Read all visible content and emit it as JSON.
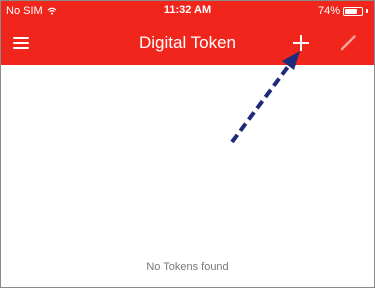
{
  "status_bar": {
    "carrier": "No SIM",
    "time": "11:32 AM",
    "battery_text": "74%",
    "battery_level": 0.74,
    "wifi_icon": "wifi-icon"
  },
  "nav_bar": {
    "title": "Digital Token",
    "menu_icon": "hamburger-menu-icon",
    "add_icon": "plus-icon",
    "edit_icon": "pencil-icon",
    "background_color": "#f0261c"
  },
  "content": {
    "empty_message": "No Tokens found"
  },
  "annotation": {
    "arrow_color": "#1f2a7a",
    "points_to": "add-token-button"
  }
}
